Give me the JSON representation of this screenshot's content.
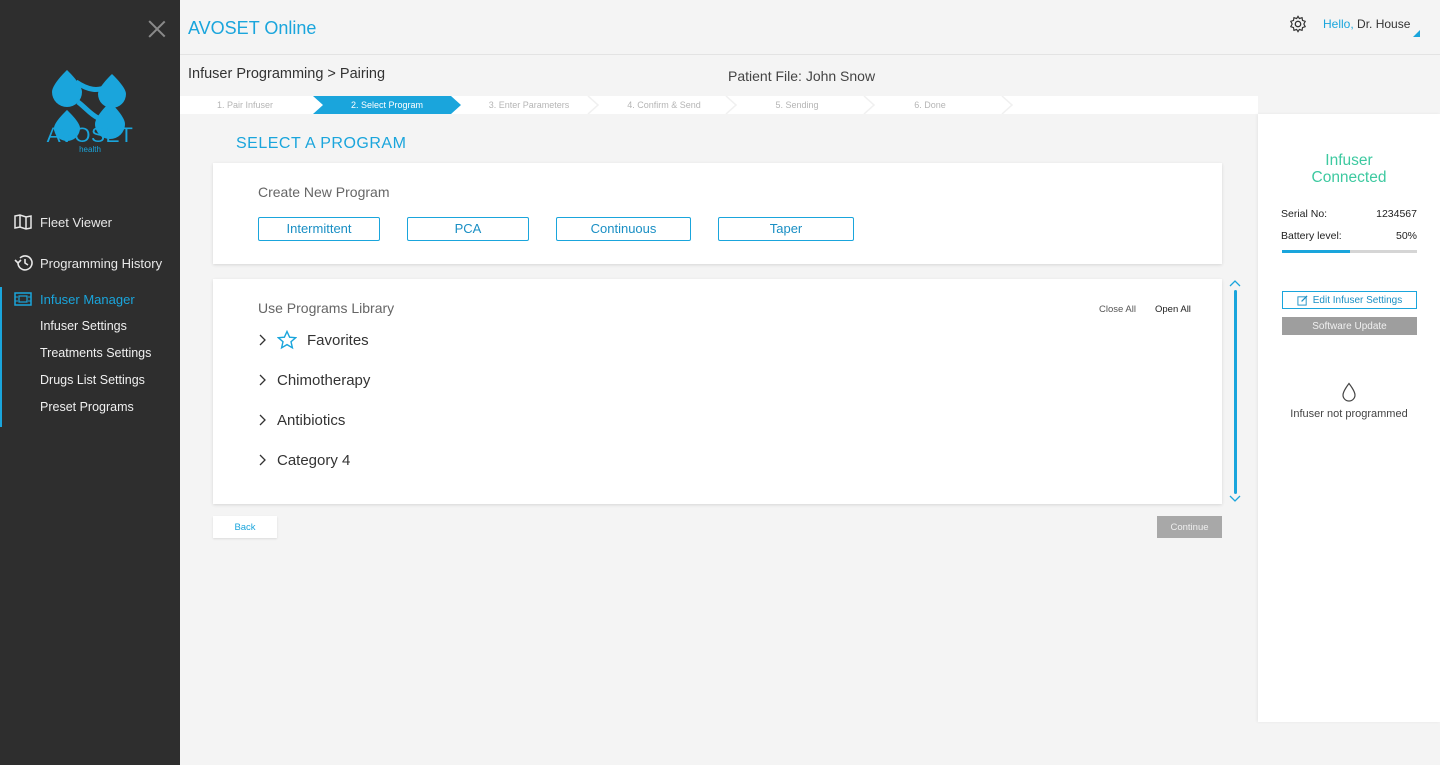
{
  "app": {
    "title": "AVOSET Online"
  },
  "brand": {
    "name": "AVOSET",
    "sub": "health",
    "color": "#1aa5dc"
  },
  "user": {
    "hello": "Hello,",
    "name": "Dr. House"
  },
  "sidebar": {
    "items": [
      {
        "label": "Fleet Viewer",
        "icon": "map-icon"
      },
      {
        "label": "Programming History",
        "icon": "history-icon"
      },
      {
        "label": "Infuser Manager",
        "icon": "infuser-icon",
        "active": true
      }
    ],
    "subitems": [
      "Infuser Settings",
      "Treatments Settings",
      "Drugs List Settings",
      "Preset Programs"
    ]
  },
  "breadcrumb": "Infuser Programming > Pairing",
  "patient": "Patient File: John Snow",
  "steps": [
    "1. Pair Infuser",
    "2. Select Program",
    "3. Enter Parameters",
    "4. Confirm & Send",
    "5. Sending",
    "6. Done"
  ],
  "active_step": 1,
  "section_title": "SELECT A PROGRAM",
  "create": {
    "label": "Create New Program",
    "buttons": [
      "Intermittent",
      "PCA",
      "Continuous",
      "Taper"
    ]
  },
  "library": {
    "label": "Use Programs Library",
    "close_all": "Close All",
    "open_all": "Open All",
    "categories": [
      "Favorites",
      "Chimotherapy",
      "Antibiotics",
      "Category 4"
    ]
  },
  "actions": {
    "back": "Back",
    "continue": "Continue"
  },
  "infuser": {
    "status_line1": "Infuser",
    "status_line2": "Connected",
    "serial_label": "Serial No:",
    "serial_value": "1234567",
    "battery_label": "Battery level:",
    "battery_value": "50%",
    "battery_fraction": 0.5,
    "edit_label": "Edit Infuser Settings",
    "software_label": "Software Update",
    "not_programmed": "Infuser not programmed"
  },
  "colors": {
    "accent": "#1aa5dc",
    "connected": "#3dc9a0",
    "sidebar": "#2e2e2e"
  }
}
